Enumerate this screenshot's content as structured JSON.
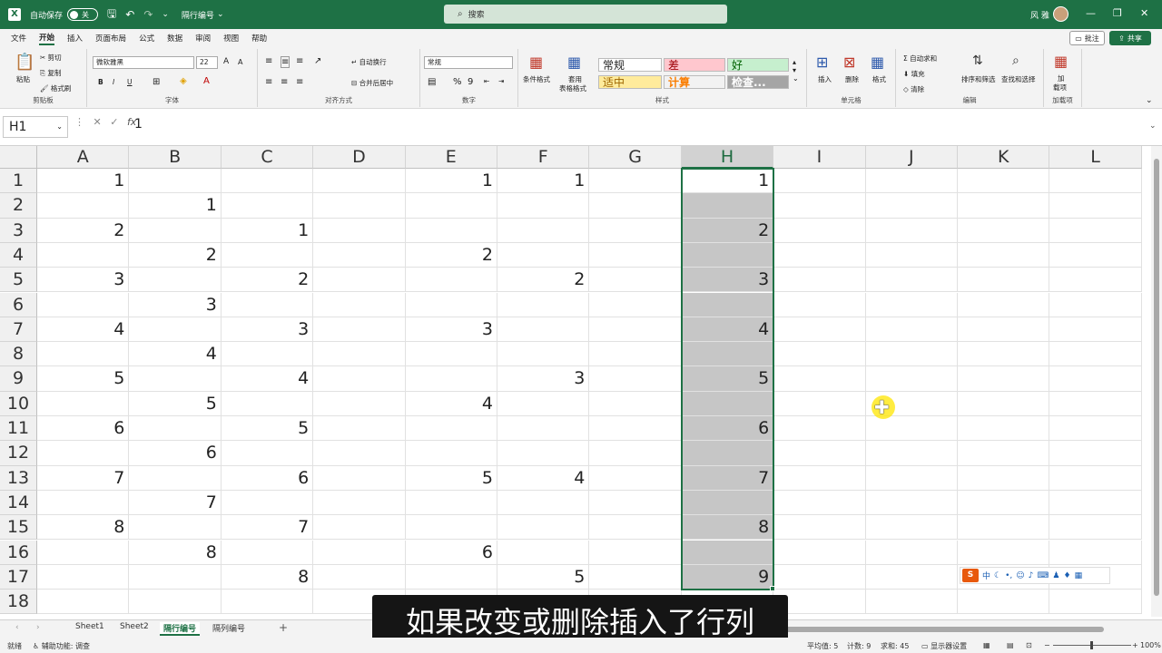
{
  "titlebar": {
    "autosave_label": "自动保存",
    "autosave_state": "关",
    "filename": "隔行编号",
    "search_placeholder": "搜索",
    "user_name": "风 雅",
    "minimize": "—",
    "restore": "❐",
    "close": "✕"
  },
  "menu": {
    "tabs": [
      "文件",
      "开始",
      "插入",
      "页面布局",
      "公式",
      "数据",
      "审阅",
      "视图",
      "帮助"
    ],
    "comment_label": "批注",
    "share_label": "共享"
  },
  "ribbon": {
    "clipboard": {
      "label": "剪贴板",
      "paste": "粘贴",
      "cut": "剪切",
      "copy": "复制",
      "format_painter": "格式刷"
    },
    "font": {
      "label": "字体",
      "font_name": "微软雅黑",
      "font_size": "22",
      "grow": "A",
      "shrink": "A",
      "bold": "B",
      "italic": "I",
      "underline": "U"
    },
    "alignment": {
      "label": "对齐方式",
      "wrap_text": "自动换行",
      "merge_center": "合并后居中"
    },
    "number": {
      "label": "数字",
      "format": "常规",
      "percent": "%",
      "comma": "9"
    },
    "styles": {
      "label": "样式",
      "conditional": "条件格式",
      "table_format_1": "套用",
      "table_format_2": "表格格式",
      "normal": "常规",
      "bad": "差",
      "good": "好",
      "neutral": "适中",
      "calculation": "计算",
      "check_cell": "检查..."
    },
    "cells": {
      "label": "单元格",
      "insert": "插入",
      "delete": "删除",
      "format": "格式"
    },
    "editing": {
      "label": "编辑",
      "autosum": "自动求和",
      "fill": "填充",
      "clear": "清除",
      "sort_filter": "排序和筛选",
      "find_select": "查找和选择"
    },
    "addins": {
      "label": "加载项",
      "btn1": "加",
      "btn2": "载项"
    }
  },
  "formula": {
    "name_box": "H1",
    "fx": "fx",
    "value": "1"
  },
  "grid": {
    "columns": [
      "A",
      "B",
      "C",
      "D",
      "E",
      "F",
      "G",
      "H",
      "I",
      "J",
      "K",
      "L"
    ],
    "rows": [
      "1",
      "2",
      "3",
      "4",
      "5",
      "6",
      "7",
      "8",
      "9",
      "10",
      "11",
      "12",
      "13",
      "14",
      "15",
      "16",
      "17",
      "18"
    ],
    "selected_column": "H",
    "cells": {
      "A": [
        "1",
        "",
        "2",
        "",
        "3",
        "",
        "4",
        "",
        "5",
        "",
        "6",
        "",
        "7",
        "",
        "8",
        "",
        "",
        ""
      ],
      "B": [
        "",
        "1",
        "",
        "2",
        "",
        "3",
        "",
        "4",
        "",
        "5",
        "",
        "6",
        "",
        "7",
        "",
        "8",
        "",
        ""
      ],
      "C": [
        "",
        "",
        "1",
        "",
        "2",
        "",
        "3",
        "",
        "4",
        "",
        "5",
        "",
        "6",
        "",
        "7",
        "",
        "8",
        ""
      ],
      "D": [
        "",
        "",
        "",
        "",
        "",
        "",
        "",
        "",
        "",
        "",
        "",
        "",
        "",
        "",
        "",
        "",
        "",
        ""
      ],
      "E": [
        "1",
        "",
        "",
        "2",
        "",
        "",
        "3",
        "",
        "",
        "4",
        "",
        "",
        "5",
        "",
        "",
        "6",
        "",
        ""
      ],
      "F": [
        "1",
        "",
        "",
        "",
        "2",
        "",
        "",
        "",
        "3",
        "",
        "",
        "",
        "4",
        "",
        "",
        "",
        "5",
        ""
      ],
      "G": [
        "",
        "",
        "",
        "",
        "",
        "",
        "",
        "",
        "",
        "",
        "",
        "",
        "",
        "",
        "",
        "",
        "",
        ""
      ],
      "H": [
        "1",
        "",
        "2",
        "",
        "3",
        "",
        "4",
        "",
        "5",
        "",
        "6",
        "",
        "7",
        "",
        "8",
        "",
        "9",
        ""
      ],
      "I": [
        "",
        "",
        "",
        "",
        "",
        "",
        "",
        "",
        "",
        "",
        "",
        "",
        "",
        "",
        "",
        "",
        "",
        ""
      ],
      "J": [
        "",
        "",
        "",
        "",
        "",
        "",
        "",
        "",
        "",
        "",
        "",
        "",
        "",
        "",
        "",
        "",
        "",
        ""
      ],
      "K": [
        "",
        "",
        "",
        "",
        "",
        "",
        "",
        "",
        "",
        "",
        "",
        "",
        "",
        "",
        "",
        "",
        "",
        ""
      ],
      "L": [
        "",
        "",
        "",
        "",
        "",
        "",
        "",
        "",
        "",
        "",
        "",
        "",
        "",
        "",
        "",
        "",
        "",
        ""
      ]
    }
  },
  "ime": {
    "logo": "S",
    "mode": "中"
  },
  "sheets": {
    "tabs": [
      "Sheet1",
      "Sheet2",
      "隔行编号",
      "隔列编号"
    ],
    "active": "隔行编号",
    "add": "+"
  },
  "subtitle": "如果改变或删除插入了行列",
  "status": {
    "ready": "就绪",
    "accessibility": "辅助功能: 调查",
    "average": "平均值: 5",
    "count": "计数: 9",
    "sum": "求和: 45",
    "display_settings": "显示器设置",
    "zoom": "100%"
  }
}
